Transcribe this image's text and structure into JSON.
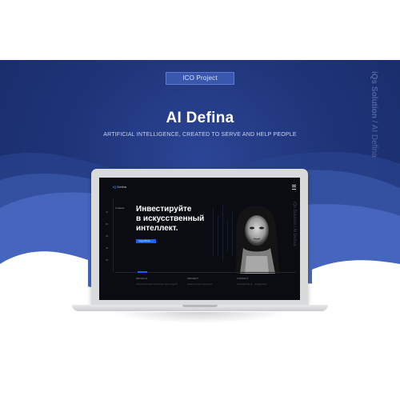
{
  "header": {
    "badge": "ICO Project",
    "title": "AI Defina",
    "subtitle": "ARTIFICIAL INTELLIGENCE, CREATED TO SERVE AND HELP PEOPLE",
    "side_text_bold": "iQs Solution",
    "side_text_thin": "/ AI Defina"
  },
  "site": {
    "logo_mark": "iQ",
    "logo_text": "Defina",
    "heading_line1": "Инвестируйте",
    "heading_line2": "в искусственный",
    "heading_line3": "интеллект.",
    "cta_label": "подробнее →",
    "nav_label": "Главная",
    "side_numbers": [
      "01",
      "02",
      "03",
      "04",
      "05"
    ],
    "vertical_text": "iQs Solution / AI Defina",
    "footer": [
      {
        "title": "DEFINA AI",
        "text": "искусственный интеллект для людей"
      },
      {
        "title": "PROJECT",
        "text": "инвестиции в будущее"
      },
      {
        "title": "CONTACT",
        "text": "info@defina.ai · поддержка"
      }
    ]
  },
  "colors": {
    "banner": "#1f3579",
    "accent": "#1d5cff",
    "screen_bg": "#0a0c11"
  }
}
